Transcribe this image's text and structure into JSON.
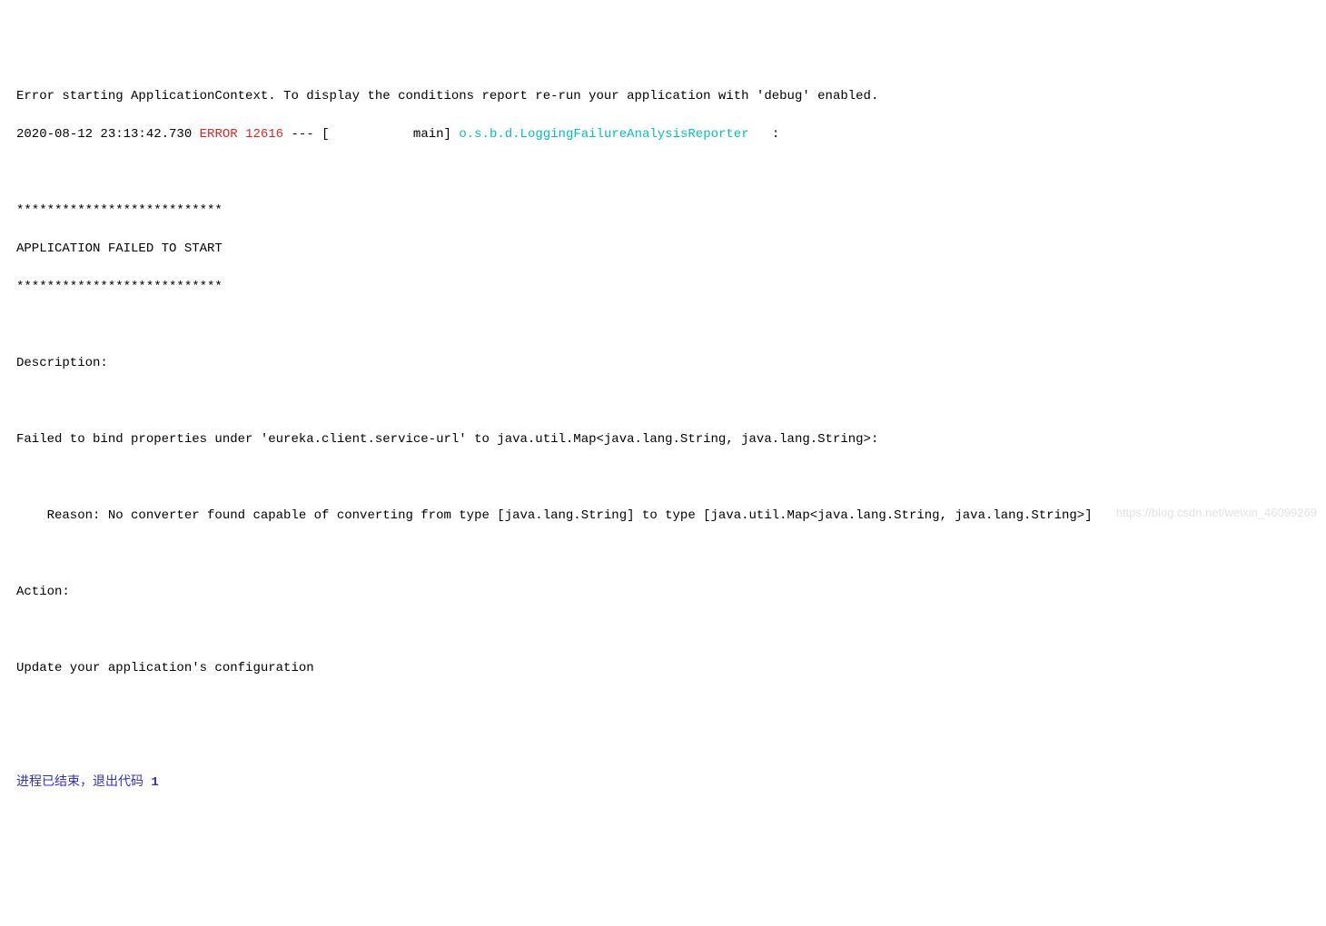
{
  "line1": "Error starting ApplicationContext. To display the conditions report re-run your application with 'debug' enabled.",
  "log": {
    "timestamp": "2020-08-12 23:13:42.730",
    "level": "ERROR",
    "pid": "12616",
    "separator": " --- [",
    "thread": "           main",
    "bracket_close": "] ",
    "logger": "o.s.b.d.LoggingFailureAnalysisReporter",
    "trailing": "   :"
  },
  "stars": "***************************",
  "fail_header": "APPLICATION FAILED TO START",
  "description_label": "Description:",
  "description_text": "Failed to bind properties under 'eureka.client.service-url' to java.util.Map<java.lang.String, java.lang.String>:",
  "reason_text": "    Reason: No converter found capable of converting from type [java.lang.String] to type [java.util.Map<java.lang.String, java.lang.String>]",
  "action_label": "Action:",
  "action_text": "Update your application's configuration",
  "exit": {
    "prefix": "进程已结束，退出代码 ",
    "code": "1"
  },
  "watermark": "https://blog.csdn.net/weixin_46099269"
}
